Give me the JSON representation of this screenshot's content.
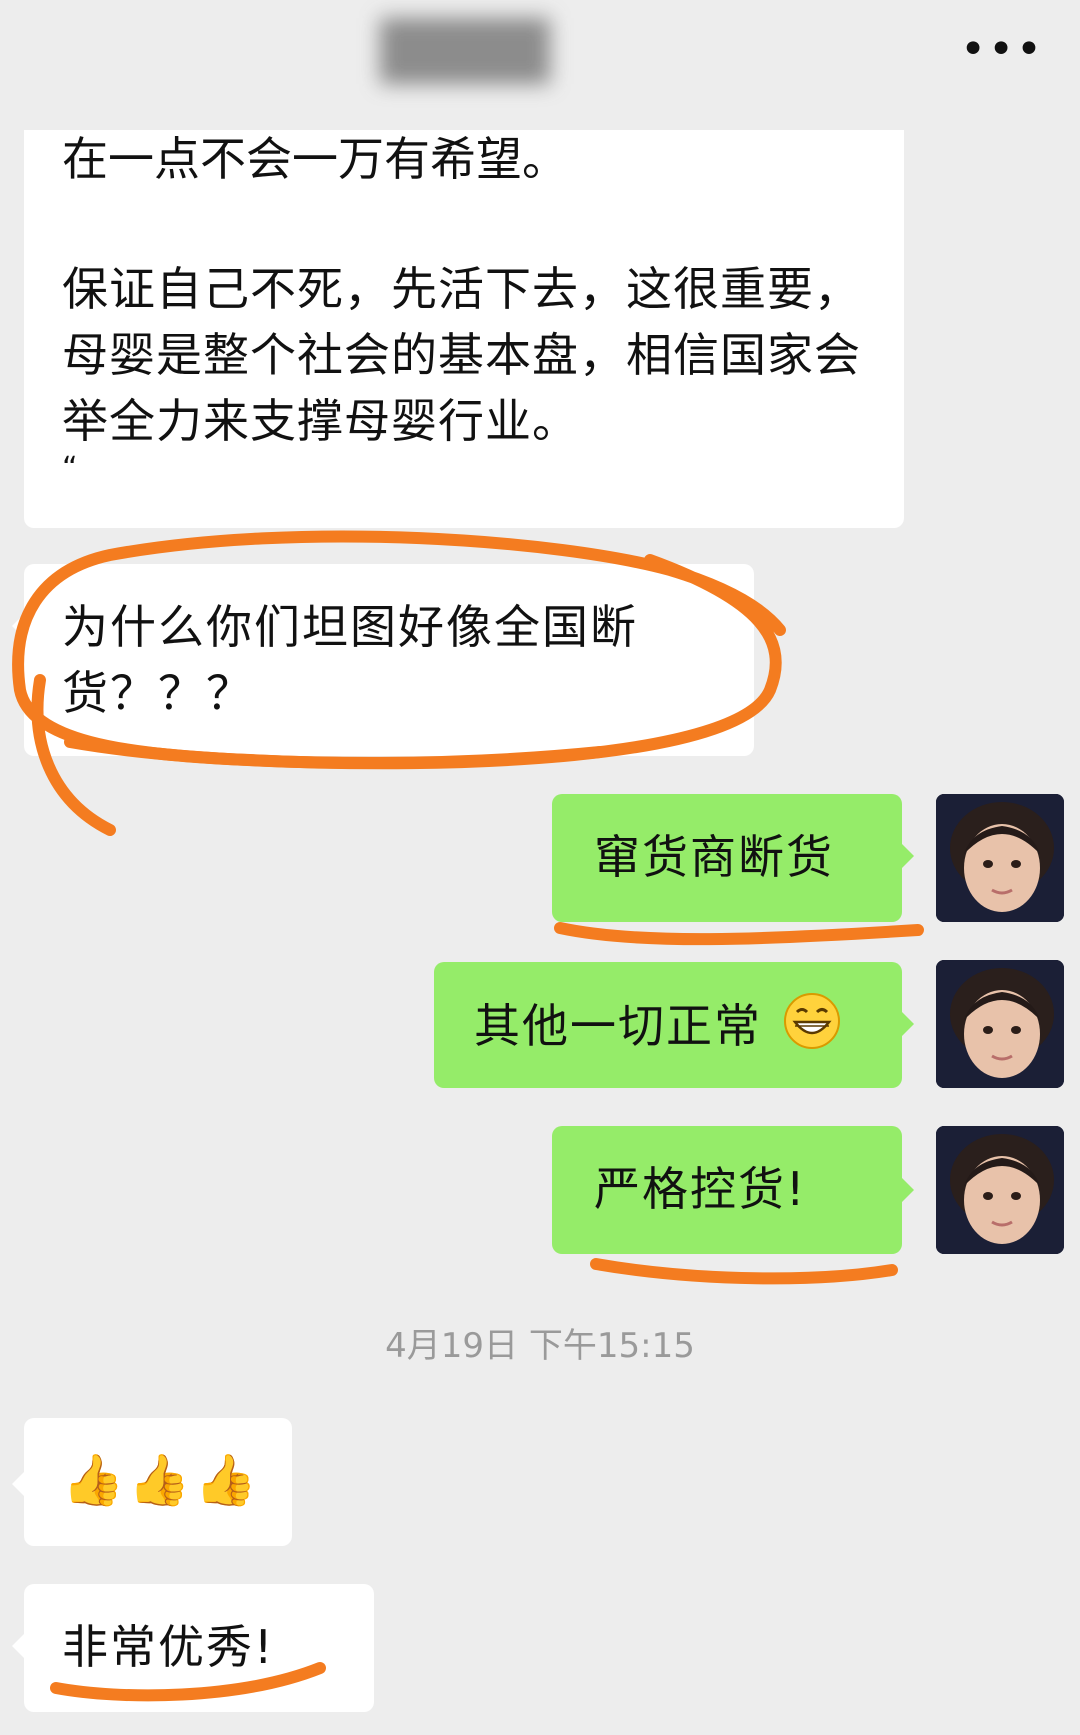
{
  "header": {
    "title": "",
    "more_icon": "more-icon",
    "more_glyph": "•••"
  },
  "messages": {
    "m1": {
      "cutoff_line": "在一点不会一万有希望。",
      "para": "保证自己不死，先活下去，这很重要，母婴是整个社会的基本盘，相信国家会举全力来支撑母婴行业。",
      "closing_quote": "“"
    },
    "m2": "为什么你们坦图好像全国断货？？？",
    "m3": "窜货商断货",
    "m4": "其他一切正常",
    "m5": "严格控货!",
    "timestamp": "4月19日 下午15:15",
    "m6": "👍👍👍",
    "m7": "非常优秀!"
  },
  "colors": {
    "background": "#ededed",
    "incoming_bubble": "#ffffff",
    "outgoing_bubble": "#95ec69",
    "annotation": "#f47c20"
  },
  "icons": {
    "grin": "grinning-emoji-icon",
    "thumbs": "thumbs-up-icon",
    "avatar": "avatar-girl"
  }
}
